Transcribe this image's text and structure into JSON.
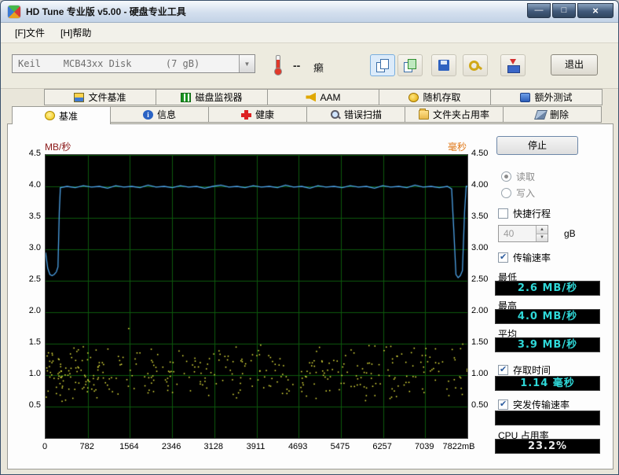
{
  "window": {
    "title": "HD Tune 专业版 v5.00 - 硬盘专业工具",
    "controls": {
      "minimize": "—",
      "maximize": "□",
      "close": "×"
    }
  },
  "menu": {
    "items": [
      {
        "label": "[F]文件"
      },
      {
        "label": "[H]帮助"
      }
    ]
  },
  "toolbar": {
    "drive_select": "Keil    MCB43xx Disk      (7 gB)",
    "temperature_value": "--",
    "temperature_unit": "癞",
    "exit_label": "退出"
  },
  "tabs": {
    "top": [
      {
        "label": "文件基准"
      },
      {
        "label": "磁盘监视器"
      },
      {
        "label": "AAM"
      },
      {
        "label": "随机存取"
      },
      {
        "label": "额外测试"
      }
    ],
    "bottom": [
      {
        "label": "基准",
        "active": true
      },
      {
        "label": "信息"
      },
      {
        "label": "健康"
      },
      {
        "label": "错误扫描"
      },
      {
        "label": "文件夹占用率"
      },
      {
        "label": "删除"
      }
    ]
  },
  "panel": {
    "stop_label": "停止",
    "read_label": "读取",
    "write_label": "写入",
    "read_selected": true,
    "shortstroke_label": "快捷行程",
    "shortstroke_checked": false,
    "shortstroke_value": "40",
    "shortstroke_unit": "gB",
    "transfer_label": "传输速率",
    "transfer_checked": true,
    "min_label": "最低",
    "min_value": "2.6 MB/秒",
    "max_label": "最高",
    "max_value": "4.0 MB/秒",
    "avg_label": "平均",
    "avg_value": "3.9 MB/秒",
    "access_label": "存取时间",
    "access_checked": true,
    "access_value": "1.14 毫秒",
    "burst_label": "突发传输速率",
    "burst_checked": true,
    "burst_value": "",
    "cpu_label": "CPU 占用率",
    "cpu_value": "23.2%",
    "colors": {
      "stat_text": "#2fd8d8",
      "stat_bg": "#000000",
      "cpu_text": "#ececec"
    }
  },
  "chart_data": {
    "type": "mixed",
    "x_range": [
      0,
      7822
    ],
    "x_unit": "mB",
    "y_range": [
      0,
      4.5
    ],
    "y_left_title": "MB/秒",
    "y_left_title_color": "#8b1818",
    "y_right_title": "毫秒",
    "y_right_title_color": "#e07818",
    "y_left_labels": [
      "4.5",
      "4.0",
      "3.5",
      "3.0",
      "2.5",
      "2.0",
      "1.5",
      "1.0",
      "0.5"
    ],
    "y_right_labels": [
      "4.50",
      "4.00",
      "3.50",
      "3.00",
      "2.50",
      "2.00",
      "1.50",
      "1.00",
      "0.50"
    ],
    "x_tick_labels": [
      "0",
      "782",
      "1564",
      "2346",
      "3128",
      "3911",
      "4693",
      "5475",
      "6257",
      "7039",
      "7822mB"
    ],
    "bg_color": "#000000",
    "grid_color": "#0c5a0c",
    "transfer_rate_line": {
      "name": "传输速率",
      "unit": "MB/秒",
      "color": "#4da3e8",
      "min": 2.6,
      "max": 4.0,
      "avg": 3.9,
      "points": [
        [
          0,
          2.95
        ],
        [
          40,
          2.7
        ],
        [
          80,
          2.6
        ],
        [
          120,
          2.58
        ],
        [
          160,
          2.6
        ],
        [
          200,
          2.64
        ],
        [
          230,
          2.72
        ],
        [
          255,
          3.6
        ],
        [
          275,
          3.98
        ],
        [
          400,
          4.0
        ],
        [
          550,
          3.98
        ],
        [
          700,
          4.01
        ],
        [
          850,
          3.99
        ],
        [
          1000,
          4.0
        ],
        [
          1150,
          3.97
        ],
        [
          1300,
          4.01
        ],
        [
          1450,
          3.99
        ],
        [
          1600,
          4.0
        ],
        [
          1750,
          3.98
        ],
        [
          1900,
          4.02
        ],
        [
          2050,
          3.99
        ],
        [
          2200,
          4.0
        ],
        [
          2350,
          3.98
        ],
        [
          2500,
          4.01
        ],
        [
          2650,
          3.99
        ],
        [
          2800,
          4.0
        ],
        [
          2950,
          3.97
        ],
        [
          3100,
          4.0
        ],
        [
          3250,
          4.02
        ],
        [
          3400,
          3.99
        ],
        [
          3550,
          4.0
        ],
        [
          3700,
          3.98
        ],
        [
          3850,
          4.01
        ],
        [
          4000,
          3.99
        ],
        [
          4150,
          4.0
        ],
        [
          4300,
          3.98
        ],
        [
          4450,
          4.02
        ],
        [
          4600,
          3.99
        ],
        [
          4750,
          4.0
        ],
        [
          4900,
          3.97
        ],
        [
          5050,
          4.01
        ],
        [
          5200,
          3.99
        ],
        [
          5350,
          4.0
        ],
        [
          5500,
          3.98
        ],
        [
          5650,
          4.01
        ],
        [
          5800,
          3.99
        ],
        [
          5950,
          4.0
        ],
        [
          6100,
          3.97
        ],
        [
          6250,
          4.01
        ],
        [
          6400,
          3.99
        ],
        [
          6550,
          4.0
        ],
        [
          6700,
          3.98
        ],
        [
          6850,
          4.02
        ],
        [
          7000,
          3.99
        ],
        [
          7150,
          4.0
        ],
        [
          7300,
          3.98
        ],
        [
          7450,
          4.0
        ],
        [
          7530,
          3.96
        ],
        [
          7570,
          3.3
        ],
        [
          7610,
          2.6
        ],
        [
          7650,
          2.55
        ],
        [
          7690,
          2.58
        ],
        [
          7730,
          2.66
        ],
        [
          7770,
          3.6
        ],
        [
          7800,
          4.0
        ],
        [
          7822,
          4.0
        ]
      ]
    },
    "access_time_scatter": {
      "name": "存取时间",
      "unit": "毫秒",
      "color": "#f0f040",
      "avg_ms": 1.14,
      "n": 380,
      "seed": 13,
      "y_min": 0.55,
      "y_max": 1.75,
      "note": "random yellow dots, densest between 0.8 and 1.3 ms across full span"
    }
  }
}
